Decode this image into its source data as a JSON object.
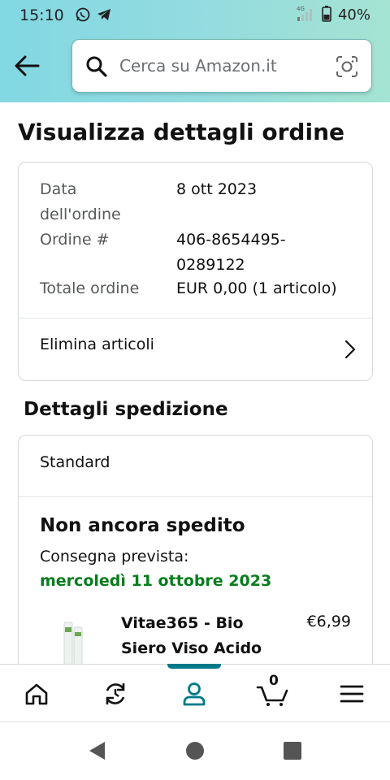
{
  "status_bar": {
    "time": "15:10",
    "network": "4G",
    "battery": "40%"
  },
  "search": {
    "placeholder": "Cerca su Amazon.it"
  },
  "page": {
    "title": "Visualizza dettagli ordine"
  },
  "order": {
    "date_label_line1": "Data",
    "date_label_line2": "dell'ordine",
    "date_value": "8 ott 2023",
    "number_label": "Ordine #",
    "number_value_line1": "406-8654495-",
    "number_value_line2": "0289122",
    "total_label": "Totale ordine",
    "total_value": "EUR 0,00 (1 articolo)",
    "remove_items_label": "Elimina articoli"
  },
  "shipping": {
    "section_title": "Dettagli spedizione",
    "type": "Standard",
    "status": "Non ancora spedito",
    "delivery_label": "Consegna prevista:",
    "delivery_date": "mercoledì 11 ottobre 2023",
    "product_name_line1": "Vitae365 - Bio",
    "product_name_line2": "Siero Viso Acido",
    "product_price": "€6,99"
  },
  "bottom_nav": {
    "items": [
      "home-icon",
      "refresh-icon",
      "account-icon",
      "cart-icon",
      "menu-icon"
    ],
    "cart_count": "0",
    "active_index": 2
  },
  "colors": {
    "accent": "#00798a",
    "delivery_green": "#067d1d"
  }
}
